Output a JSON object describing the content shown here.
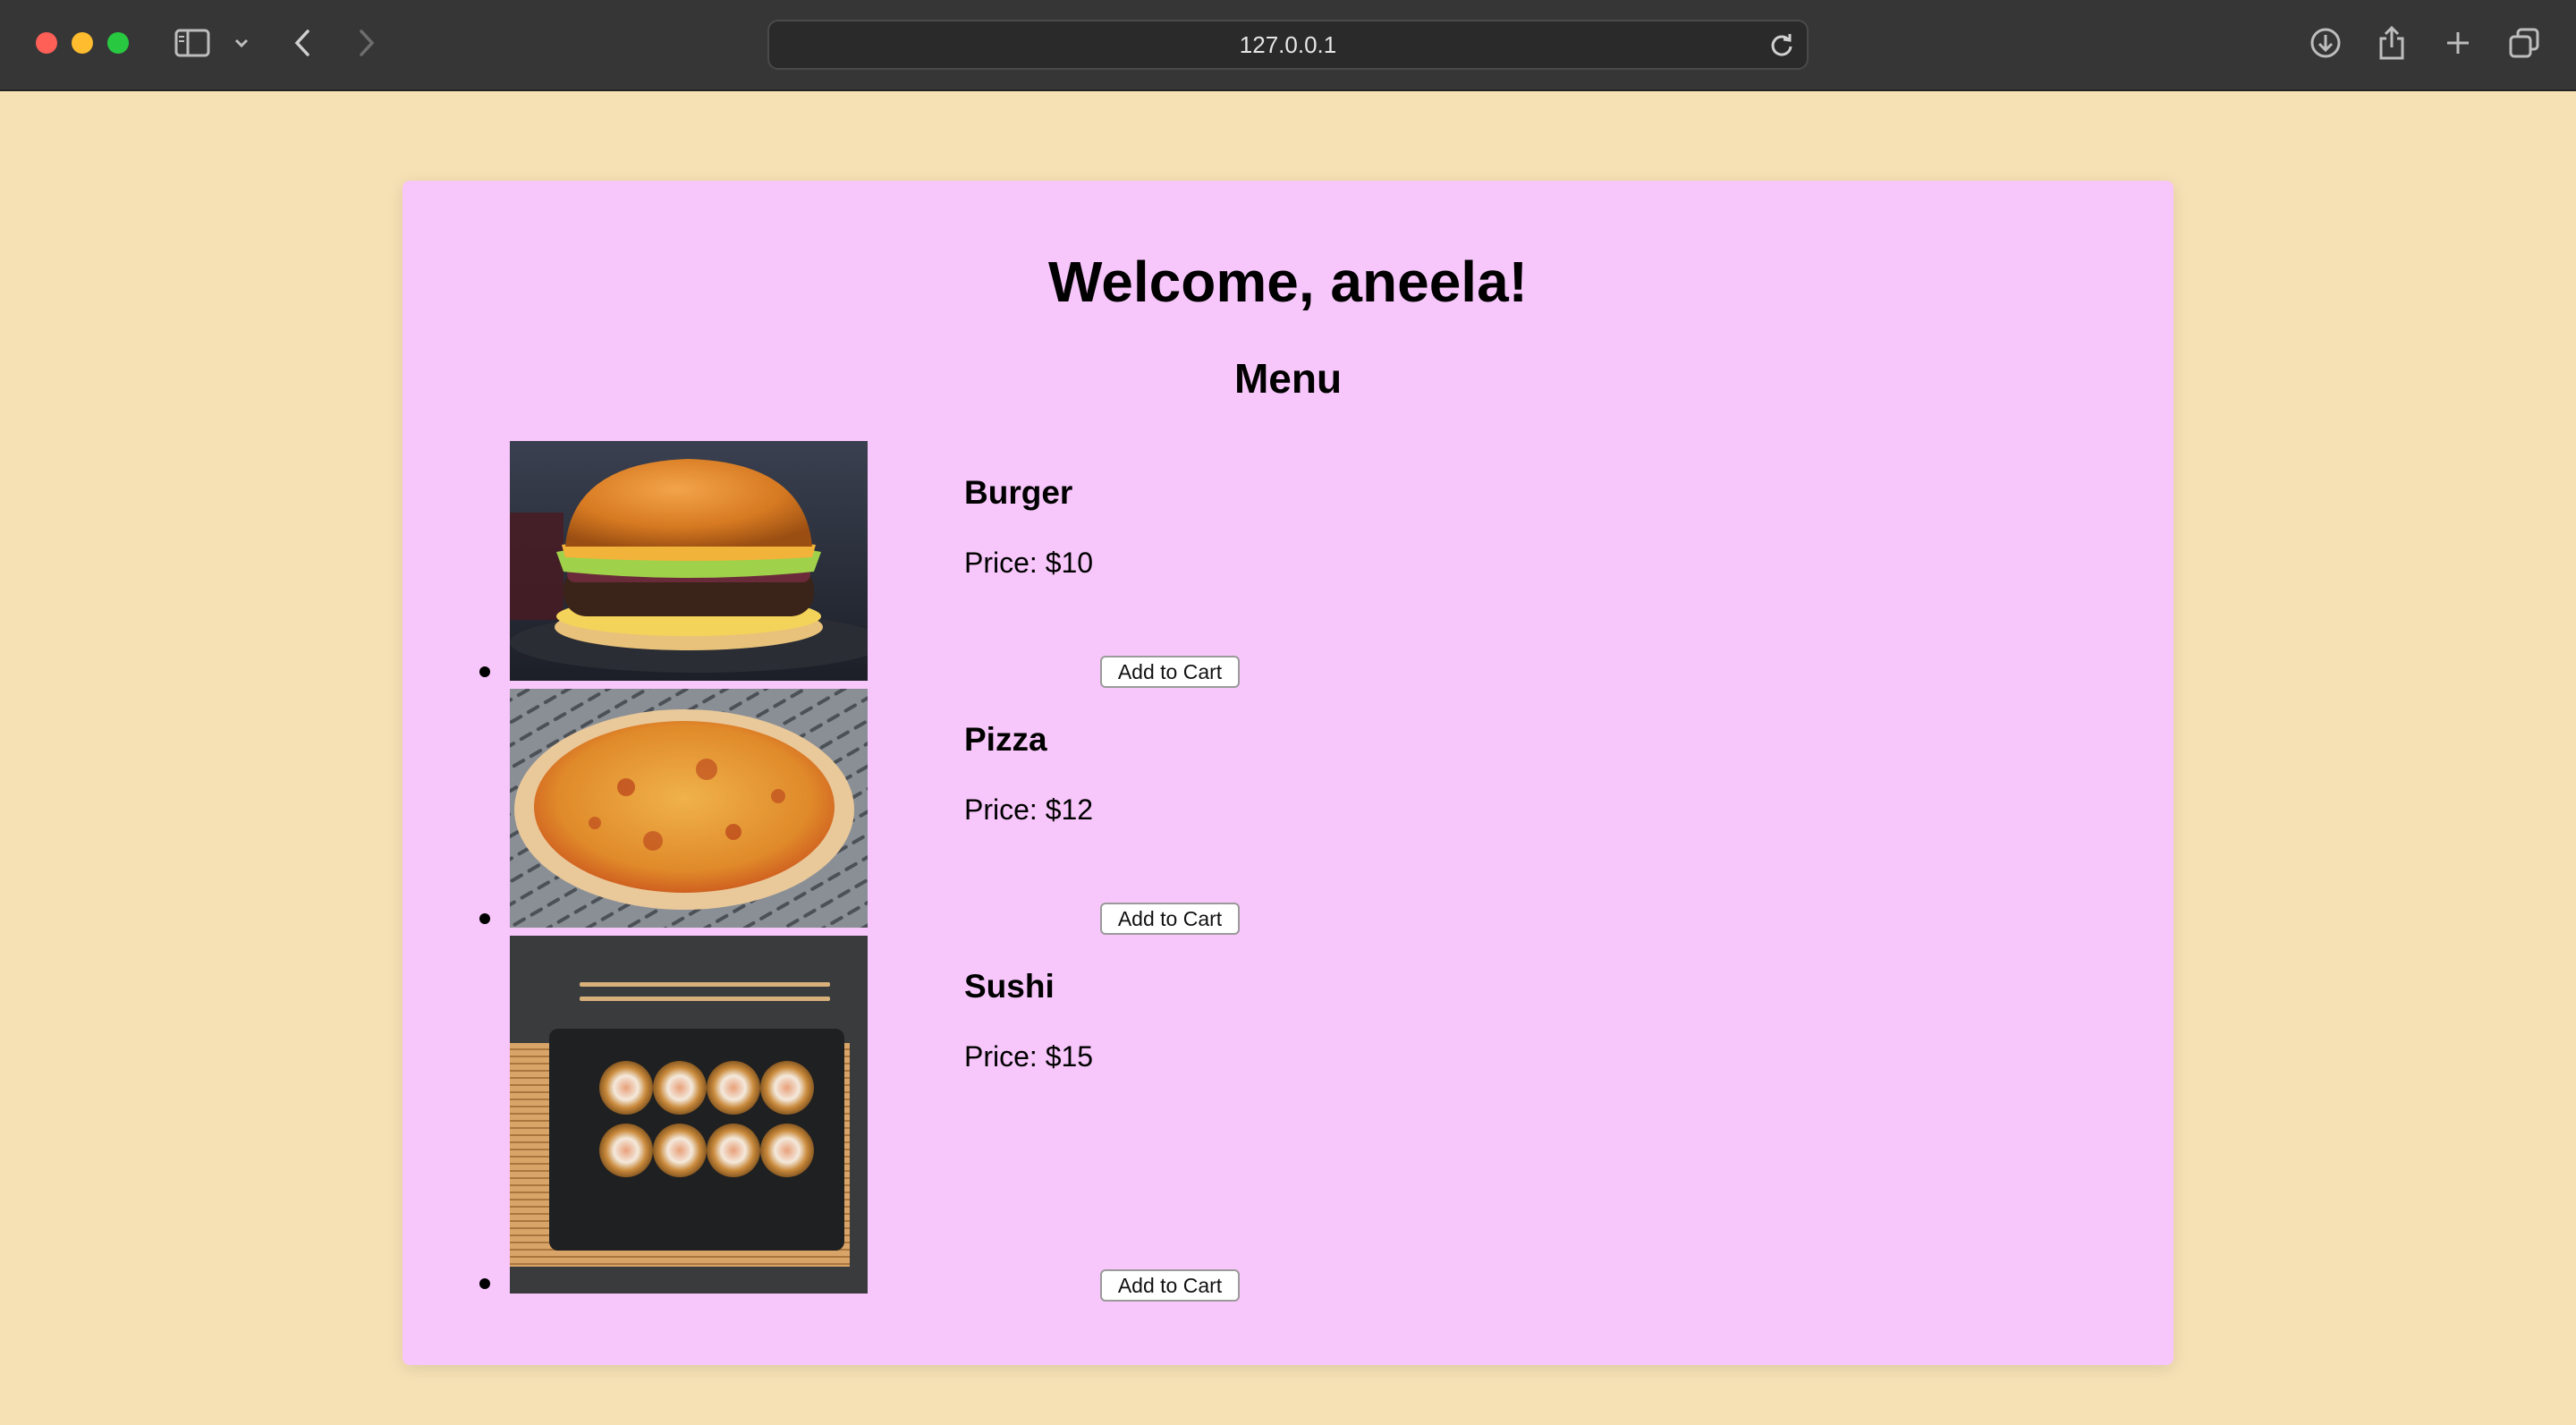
{
  "browser": {
    "url": "127.0.0.1",
    "icons": [
      "sidebar-icon",
      "chevron-down-icon",
      "back-icon",
      "forward-icon",
      "reload-icon",
      "download-icon",
      "share-icon",
      "new-tab-icon",
      "tab-overview-icon"
    ]
  },
  "page": {
    "welcome": "Welcome, aneela!",
    "menu_title": "Menu"
  },
  "menu": {
    "items": [
      {
        "name": "Burger",
        "price": "Price: $10",
        "button": "Add to Cart",
        "image": "burger"
      },
      {
        "name": "Pizza",
        "price": "Price: $12",
        "button": "Add to Cart",
        "image": "pizza"
      },
      {
        "name": "Sushi",
        "price": "Price: $15",
        "button": "Add to Cart",
        "image": "sushi"
      }
    ]
  },
  "colors": {
    "page_background": "#f6e1b5",
    "card_background": "#f7c6fa",
    "chrome_background": "#363636"
  }
}
